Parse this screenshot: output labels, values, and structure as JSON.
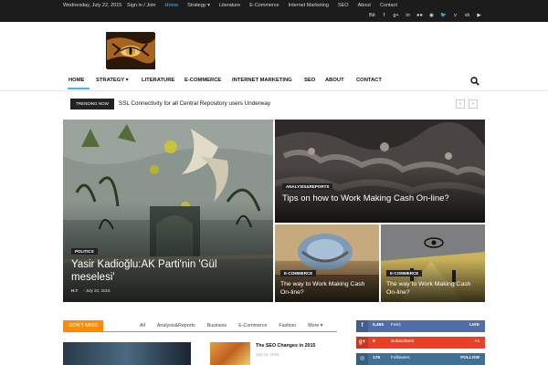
{
  "topbar": {
    "date": "Wednesday, July 22, 2015",
    "menu": [
      "Sign in / Join",
      "Home",
      "Strategy ▾",
      "Literature",
      "E-Commerce",
      "Internet Marketing",
      "SEO",
      "About",
      "Contact"
    ],
    "social_icons": [
      "behance-icon",
      "facebook-icon",
      "google-plus-icon",
      "linkedin-icon",
      "flickr-icon",
      "rss-icon",
      "twitter-icon",
      "vimeo-icon",
      "vk-icon",
      "youtube-icon"
    ],
    "social_glyphs": [
      "Bē",
      "f",
      "g+",
      "in",
      "●●",
      "◉",
      "🐦",
      "v",
      "vk",
      "▶"
    ]
  },
  "nav": {
    "items": [
      "HOME",
      "STRATEGY ▾",
      "LITERATURE",
      "E-COMMERCE",
      "INTERNET MARKETING",
      "SEO",
      "ABOUT",
      "CONTACT"
    ],
    "active": "HOME",
    "accent": "#4db2ec"
  },
  "trending": {
    "label": "TRENDING NOW",
    "text": "SSL Connectivity for all Central Repository users Underway",
    "prev": "‹",
    "next": "›"
  },
  "featured": {
    "big": {
      "category": "POLITICS",
      "title": "Yasir Kadioğlu:AK Parti'nin 'Gül meselesi'",
      "author": "H.T",
      "date": "July 20, 2016"
    },
    "top_right": {
      "category": "ANALYSIS&REPORTS",
      "title": "Tips on how to Work Making Cash On-line?"
    },
    "bottom_left": {
      "category": "E-COMMERCE",
      "title": "The way to Work Making Cash On-line?"
    },
    "bottom_right": {
      "category": "E-COMMERCE",
      "title": "The way to Work Making Cash On-line?"
    }
  },
  "dont_miss": {
    "label": "DON'T MISS",
    "accent": "#ff8b00",
    "tabs": [
      "All",
      "Analysis&Reports",
      "Business",
      "E-Commerce",
      "Fashion",
      "More ▾"
    ],
    "article": {
      "title": "The SEO Changes in 2015",
      "date": "July 11, 2015"
    }
  },
  "social_counters": [
    {
      "icon": "facebook-icon",
      "glyph": "f",
      "count": "5,465",
      "label": "Fans",
      "action": "LIKE",
      "color": "#516eab"
    },
    {
      "icon": "google-plus-icon",
      "glyph": "g+",
      "count": "8",
      "label": "Subscribers",
      "action": "+1",
      "color": "#eb4026"
    },
    {
      "icon": "instagram-icon",
      "glyph": "◎",
      "count": "176",
      "label": "Followers",
      "action": "FOLLOW",
      "color": "#417096"
    }
  ]
}
